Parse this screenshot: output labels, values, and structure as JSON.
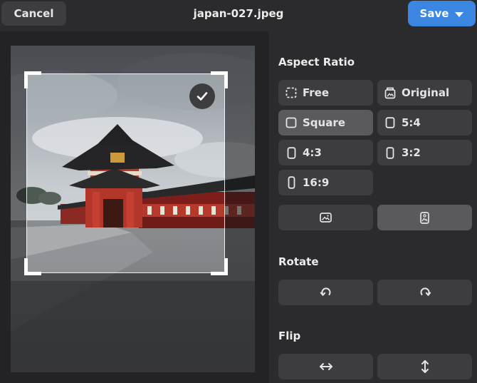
{
  "topbar": {
    "cancel_label": "Cancel",
    "file_name": "japan-027.jpeg",
    "save_label": "Save"
  },
  "aspect_ratio": {
    "title": "Aspect Ratio",
    "selected": "Square",
    "options": [
      {
        "label": "Free",
        "icon": "dashed-square-icon"
      },
      {
        "label": "Original",
        "icon": "original-image-icon"
      },
      {
        "label": "Square",
        "icon": "square-icon"
      },
      {
        "label": "5:4",
        "icon": "portrait-rect-icon"
      },
      {
        "label": "4:3",
        "icon": "portrait-rect-icon"
      },
      {
        "label": "3:2",
        "icon": "portrait-rect-icon"
      },
      {
        "label": "16:9",
        "icon": "portrait-rect-icon"
      }
    ],
    "orientation": {
      "landscape_icon": "landscape-image-icon",
      "portrait_icon": "portrait-image-icon",
      "selected": "portrait"
    }
  },
  "rotate": {
    "title": "Rotate",
    "left_icon": "rotate-left-icon",
    "right_icon": "rotate-right-icon"
  },
  "flip": {
    "title": "Flip",
    "horizontal_icon": "flip-horizontal-icon",
    "vertical_icon": "flip-vertical-icon"
  },
  "colors": {
    "background": "#2b2b2d",
    "button": "#3d3d40",
    "button_selected": "#5a5a5e",
    "accent": "#3a86e0"
  }
}
